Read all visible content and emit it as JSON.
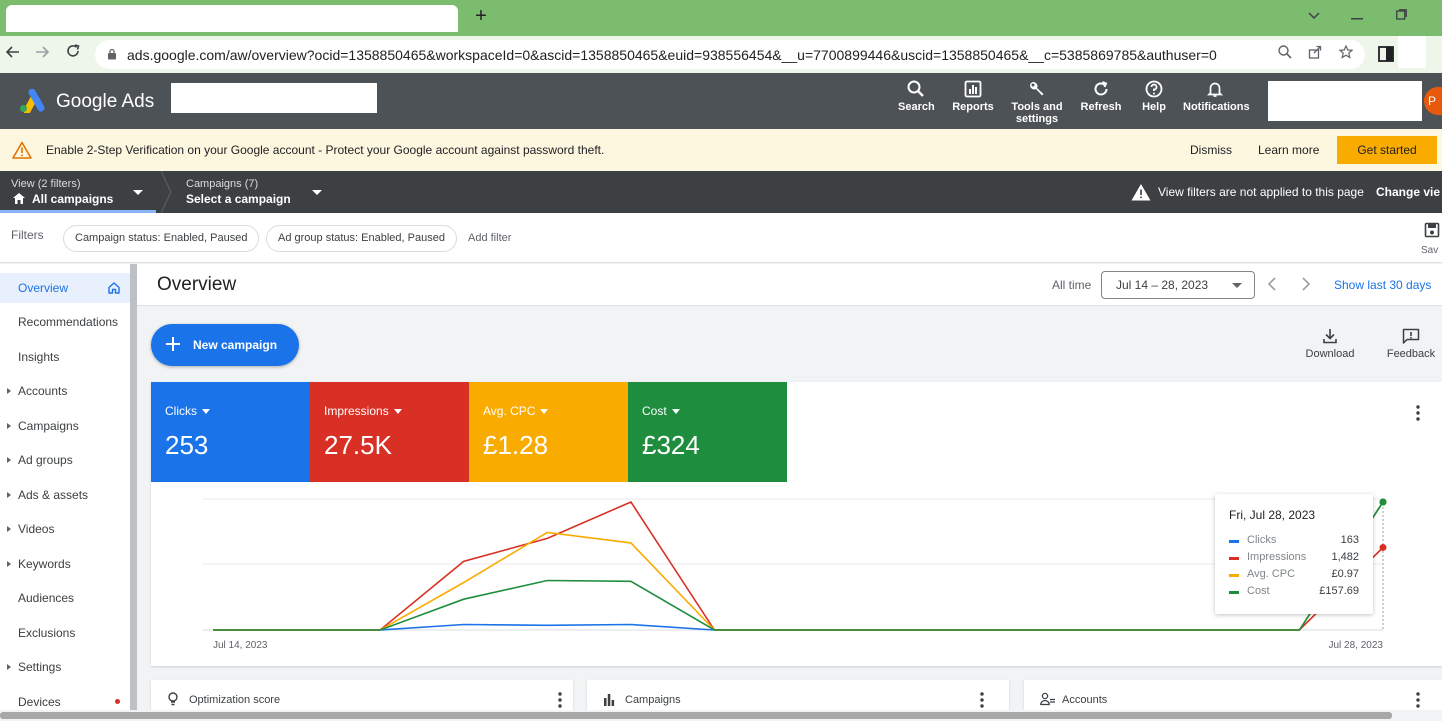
{
  "browser": {
    "url": "ads.google.com/aw/overview?ocid=1358850465&workspaceId=0&ascid=1358850465&euid=938556454&__u=7700899446&uscid=1358850465&__c=5385869785&authuser=0",
    "new_tab": "+"
  },
  "header": {
    "brand": "Google Ads",
    "nav": [
      {
        "label": "Search",
        "icon": "search-icon"
      },
      {
        "label": "Reports",
        "icon": "reports-icon"
      },
      {
        "label": "Tools and settings",
        "icon": "wrench-icon"
      },
      {
        "label": "Refresh",
        "icon": "refresh-icon"
      },
      {
        "label": "Help",
        "icon": "help-icon"
      },
      {
        "label": "Notifications",
        "icon": "bell-icon"
      }
    ],
    "avatar_initial": "P"
  },
  "banner": {
    "title": "Enable 2-Step Verification on your Google account",
    "message": " - Protect your Google account against password theft.",
    "dismiss": "Dismiss",
    "learn_more": "Learn more",
    "get_started": "Get started"
  },
  "viewbar": {
    "view_small": "View (2 filters)",
    "view_main": "All campaigns",
    "campaign_small": "Campaigns (7)",
    "campaign_main": "Select a campaign",
    "notice": "View filters are not applied to this page",
    "change_view": "Change vie"
  },
  "filters": {
    "label": "Filters",
    "chips": [
      "Campaign status: Enabled, Paused",
      "Ad group status: Enabled, Paused"
    ],
    "add_filter": "Add filter",
    "save": "Sav"
  },
  "sidebar": {
    "items": [
      {
        "label": "Overview",
        "active": true
      },
      {
        "label": "Recommendations"
      },
      {
        "label": "Insights"
      },
      {
        "label": "Accounts",
        "expandable": true
      },
      {
        "label": "Campaigns",
        "expandable": true
      },
      {
        "label": "Ad groups",
        "expandable": true
      },
      {
        "label": "Ads & assets",
        "expandable": true
      },
      {
        "label": "Videos",
        "expandable": true
      },
      {
        "label": "Keywords",
        "expandable": true
      },
      {
        "label": "Audiences"
      },
      {
        "label": "Exclusions"
      },
      {
        "label": "Settings",
        "expandable": true
      },
      {
        "label": "Devices"
      }
    ]
  },
  "overview": {
    "title": "Overview",
    "all_time": "All time",
    "date_range": "Jul 14 – 28, 2023",
    "show_last": "Show last 30 days",
    "new_campaign": "New campaign",
    "download": "Download",
    "feedback": "Feedback"
  },
  "metrics": [
    {
      "name": "Clicks",
      "value": "253",
      "color": "#1a73e8"
    },
    {
      "name": "Impressions",
      "value": "27.5K",
      "color": "#d93025"
    },
    {
      "name": "Avg. CPC",
      "value": "£1.28",
      "color": "#f9ab00"
    },
    {
      "name": "Cost",
      "value": "£324",
      "color": "#1e8e3e"
    }
  ],
  "chart_data": {
    "type": "line",
    "x_start_label": "Jul 14, 2023",
    "x_end_label": "Jul 28, 2023",
    "x": [
      "Jul 14",
      "Jul 15",
      "Jul 16",
      "Jul 17",
      "Jul 18",
      "Jul 19",
      "Jul 20",
      "Jul 21",
      "Jul 22",
      "Jul 23",
      "Jul 24",
      "Jul 25",
      "Jul 26",
      "Jul 27",
      "Jul 28"
    ],
    "grid": true,
    "series": [
      {
        "name": "Clicks",
        "color": "#1a73e8",
        "values": [
          0,
          0,
          0,
          7,
          6,
          7,
          0,
          0,
          0,
          0,
          0,
          0,
          0,
          0,
          163
        ]
      },
      {
        "name": "Impressions",
        "color": "#d93025",
        "values": [
          0,
          0,
          0,
          1232,
          1645,
          2298,
          0,
          0,
          0,
          0,
          0,
          0,
          0,
          0,
          1482
        ]
      },
      {
        "name": "Avg. CPC",
        "color": "#f9ab00",
        "values": [
          0,
          0,
          0,
          0.36,
          0.74,
          0.66,
          0,
          0,
          0,
          0,
          0,
          0,
          0,
          0,
          0.97
        ]
      },
      {
        "name": "Cost",
        "color": "#1e8e3e",
        "values": [
          0,
          0,
          0,
          38,
          61,
          60,
          0,
          0,
          0,
          0,
          0,
          0,
          0,
          0,
          157.69
        ]
      }
    ]
  },
  "tooltip": {
    "date": "Fri, Jul 28, 2023",
    "rows": [
      {
        "name": "Clicks",
        "value": "163",
        "color": "#1a73e8"
      },
      {
        "name": "Impressions",
        "value": "1,482",
        "color": "#d93025"
      },
      {
        "name": "Avg. CPC",
        "value": "£0.97",
        "color": "#f9ab00"
      },
      {
        "name": "Cost",
        "value": "£157.69",
        "color": "#1e8e3e"
      }
    ]
  },
  "cards": {
    "optimization": "Optimization score",
    "campaigns": "Campaigns",
    "accounts": "Accounts"
  }
}
